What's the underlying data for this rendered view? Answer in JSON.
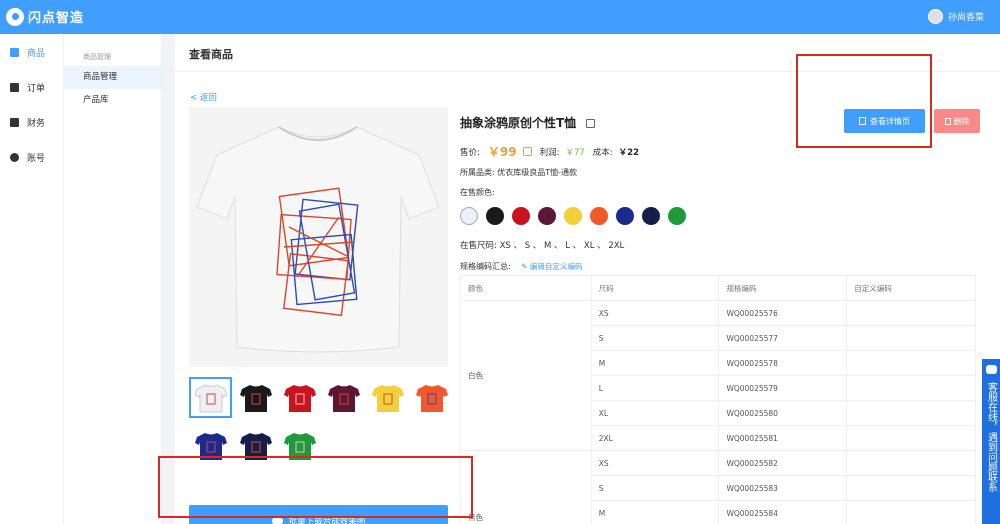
{
  "header": {
    "logo_text": "闪点智造",
    "user_name": "孙尚香菜"
  },
  "sidebar": {
    "items": [
      {
        "label": "商品",
        "icon": "bag-icon"
      },
      {
        "label": "订单",
        "icon": "list-icon"
      },
      {
        "label": "财务",
        "icon": "shield-icon"
      },
      {
        "label": "账号",
        "icon": "user-icon"
      }
    ]
  },
  "subnav": {
    "title": "商品管理",
    "items": [
      "商品管理",
      "产品库"
    ]
  },
  "page": {
    "title": "查看商品",
    "back": "< 返回"
  },
  "product": {
    "title": "抽象涂鸦原创个性T恤",
    "price_label": "售价:",
    "price": "￥99",
    "profit_label": "利润:",
    "profit": "￥77",
    "cost_label": "成本:",
    "cost": "￥22",
    "category": "所属品类: 优衣库级良品T恤-通款",
    "colors_label": "在售颜色:",
    "colors": [
      "#eef0f5",
      "#1a1a1a",
      "#c8141e",
      "#5c1736",
      "#f2d03c",
      "#f2592a",
      "#1b2a8c",
      "#14204a",
      "#1f9a3a"
    ],
    "sizes": "在售尺码: XS 、 S 、 M 、 L 、 XL 、 2XL",
    "codes_label": "规格编码汇总:",
    "codes_edit": "编辑自定义编码",
    "detail_button": "查看详情页",
    "delete_button": "删除",
    "download_button": "批量下载合成效果图"
  },
  "table": {
    "headers": [
      "颜色",
      "尺码",
      "规格编码",
      "自定义编码"
    ],
    "groups": [
      {
        "color": "白色",
        "rows": [
          {
            "size": "XS",
            "code": "WQ00025576"
          },
          {
            "size": "S",
            "code": "WQ00025577"
          },
          {
            "size": "M",
            "code": "WQ00025578"
          },
          {
            "size": "L",
            "code": "WQ00025579"
          },
          {
            "size": "XL",
            "code": "WQ00025580"
          },
          {
            "size": "2XL",
            "code": "WQ00025581"
          }
        ]
      },
      {
        "color": "黑色",
        "rows": [
          {
            "size": "XS",
            "code": "WQ00025582"
          },
          {
            "size": "S",
            "code": "WQ00025583"
          },
          {
            "size": "M",
            "code": "WQ00025584"
          }
        ]
      }
    ]
  },
  "side_chat": {
    "text": "客服在线，遇到问题联系"
  }
}
